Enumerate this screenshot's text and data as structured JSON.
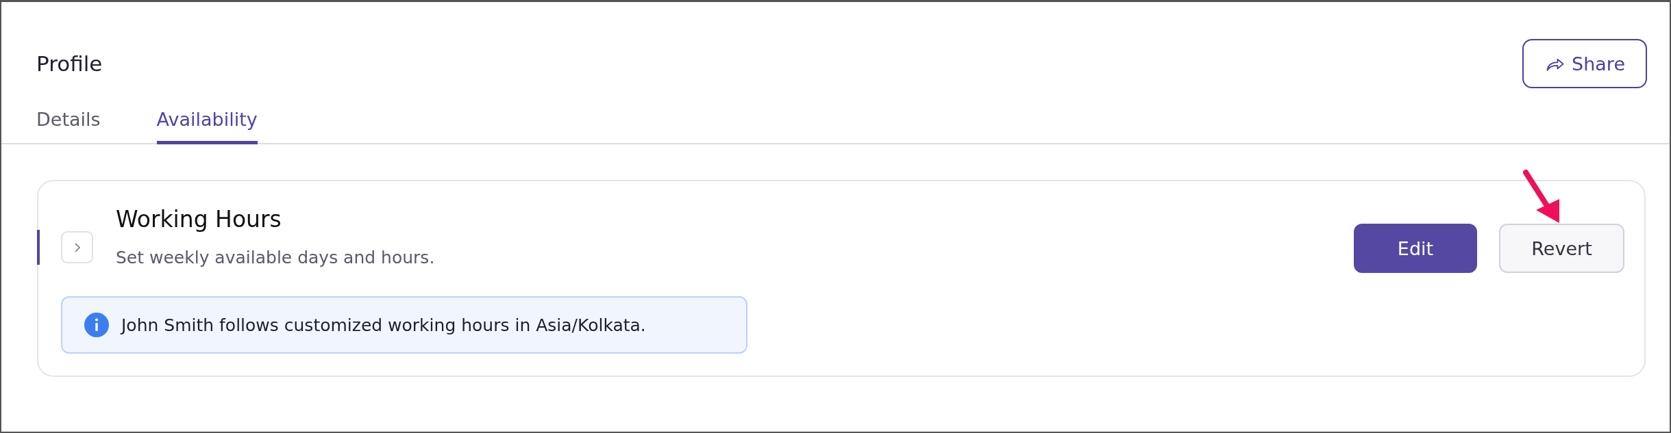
{
  "header": {
    "title": "Profile",
    "share_button": "Share"
  },
  "tabs": [
    {
      "label": "Details",
      "selected": false
    },
    {
      "label": "Availability",
      "selected": true
    }
  ],
  "section": {
    "title": "Working Hours",
    "description": "Set weekly available days and hours.",
    "expanded": false,
    "active": true,
    "buttons": [
      {
        "label": "Edit",
        "kind": "primary"
      },
      {
        "label": "Revert",
        "kind": "secondary"
      }
    ],
    "info": "John Smith follows customized working hours in Asia/Kolkata."
  }
}
